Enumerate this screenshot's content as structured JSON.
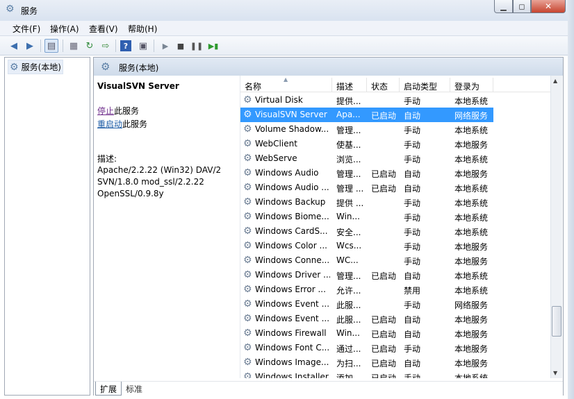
{
  "window": {
    "title": "服务",
    "min_label": "▁",
    "max_label": "◻",
    "close_label": "✕"
  },
  "menu": [
    "文件(F)",
    "操作(A)",
    "查看(V)",
    "帮助(H)"
  ],
  "toolbar": {
    "icons": [
      "back-arrow-icon",
      "forward-arrow-icon",
      "console-tree-icon",
      "properties-icon",
      "refresh-icon",
      "export-list-icon",
      "help-icon",
      "view-icon",
      "play-icon",
      "stop-icon",
      "pause-icon",
      "restart-icon"
    ]
  },
  "tree": {
    "root_label": "服务(本地)"
  },
  "panel": {
    "header": "服务(本地)"
  },
  "detail": {
    "title": "VisualSVN Server",
    "stop_link": "停止",
    "stop_suffix": "此服务",
    "restart_link": "重启动",
    "restart_suffix": "此服务",
    "desc_label": "描述:",
    "desc_lines": [
      "Apache/2.2.22 (Win32) DAV/2",
      "SVN/1.8.0 mod_ssl/2.2.22",
      "OpenSSL/0.9.8y"
    ]
  },
  "columns": [
    "名称",
    "描述",
    "状态",
    "启动类型",
    "登录为"
  ],
  "rows": [
    {
      "name": "Virtual Disk",
      "desc": "提供...",
      "status": "",
      "startup": "手动",
      "logon": "本地系统"
    },
    {
      "name": "VisualSVN Server",
      "desc": "Apa...",
      "status": "已启动",
      "startup": "自动",
      "logon": "网络服务"
    },
    {
      "name": "Volume Shadow...",
      "desc": "管理...",
      "status": "",
      "startup": "手动",
      "logon": "本地系统"
    },
    {
      "name": "WebClient",
      "desc": "使基...",
      "status": "",
      "startup": "手动",
      "logon": "本地服务"
    },
    {
      "name": "WebServe",
      "desc": "浏览...",
      "status": "",
      "startup": "手动",
      "logon": "本地系统"
    },
    {
      "name": "Windows Audio",
      "desc": "管理...",
      "status": "已启动",
      "startup": "自动",
      "logon": "本地服务"
    },
    {
      "name": "Windows Audio ...",
      "desc": "管理 ...",
      "status": "已启动",
      "startup": "自动",
      "logon": "本地系统"
    },
    {
      "name": "Windows Backup",
      "desc": "提供 ...",
      "status": "",
      "startup": "手动",
      "logon": "本地系统"
    },
    {
      "name": "Windows Biome...",
      "desc": "Win...",
      "status": "",
      "startup": "手动",
      "logon": "本地系统"
    },
    {
      "name": "Windows CardS...",
      "desc": "安全...",
      "status": "",
      "startup": "手动",
      "logon": "本地系统"
    },
    {
      "name": "Windows Color ...",
      "desc": "Wcs...",
      "status": "",
      "startup": "手动",
      "logon": "本地服务"
    },
    {
      "name": "Windows Conne...",
      "desc": "WC...",
      "status": "",
      "startup": "手动",
      "logon": "本地服务"
    },
    {
      "name": "Windows Driver ...",
      "desc": "管理...",
      "status": "已启动",
      "startup": "自动",
      "logon": "本地系统"
    },
    {
      "name": "Windows Error ...",
      "desc": "允许...",
      "status": "",
      "startup": "禁用",
      "logon": "本地系统"
    },
    {
      "name": "Windows Event ...",
      "desc": "此服...",
      "status": "",
      "startup": "手动",
      "logon": "网络服务"
    },
    {
      "name": "Windows Event ...",
      "desc": "此服...",
      "status": "已启动",
      "startup": "自动",
      "logon": "本地服务"
    },
    {
      "name": "Windows Firewall",
      "desc": "Win...",
      "status": "已启动",
      "startup": "自动",
      "logon": "本地服务"
    },
    {
      "name": "Windows Font C...",
      "desc": "通过...",
      "status": "已启动",
      "startup": "手动",
      "logon": "本地服务"
    },
    {
      "name": "Windows Image...",
      "desc": "为扫...",
      "status": "已启动",
      "startup": "自动",
      "logon": "本地服务"
    },
    {
      "name": "Windows Installer",
      "desc": "添加...",
      "status": "已启动",
      "startup": "手动",
      "logon": "本地系统"
    }
  ],
  "selected_row": 1,
  "tabs": [
    "扩展",
    "标准"
  ],
  "colors": {
    "selection": "#3399ff",
    "link_visited": "#6f2e8c",
    "link": "#1a5aa5"
  }
}
